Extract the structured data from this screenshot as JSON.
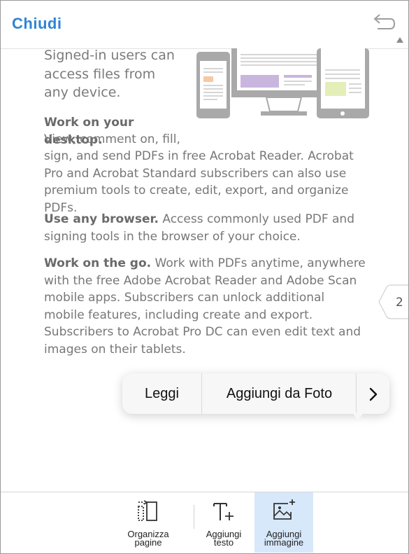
{
  "header": {
    "close_label": "Chiudi",
    "undo_icon": "undo-icon"
  },
  "document": {
    "intro": "Signed-in users can access files from any device.",
    "sections": [
      {
        "heading": "Work on your desktop.",
        "body_line1": "View, comment on, fill,",
        "body_rest": "sign, and send PDFs in free Acrobat Reader. Acrobat Pro and Acrobat Standard subscribers can also use premium tools to create, edit, export, and organize PDFs."
      },
      {
        "heading": "Use any browser.",
        "body": " Access commonly used PDF and signing tools in the browser of your choice."
      },
      {
        "heading": "Work on the go.",
        "body": " Work with PDFs anytime, anywhere with the free Adobe Acrobat Reader and Adobe Scan mobile apps. Subscribers can unlock additional mobile features, including create and export. Subscribers to Acrobat Pro DC can even edit text and images on their tablets."
      }
    ],
    "page_number": "2"
  },
  "context_menu": {
    "items": [
      {
        "label": "Leggi"
      },
      {
        "label": "Aggiungi da Foto"
      }
    ],
    "more_icon": "chevron-right-icon"
  },
  "toolbar": {
    "tools": [
      {
        "label": "Organizza\npagine",
        "icon": "organize-pages-icon"
      },
      {
        "label": "Aggiungi\ntesto",
        "icon": "add-text-icon"
      },
      {
        "label": "Aggiungi\nimmagine",
        "icon": "add-image-icon",
        "selected": true
      }
    ]
  },
  "colors": {
    "accent": "#2d84d4",
    "selected_tool_bg": "#d8e8fb",
    "body_text": "#777777"
  }
}
